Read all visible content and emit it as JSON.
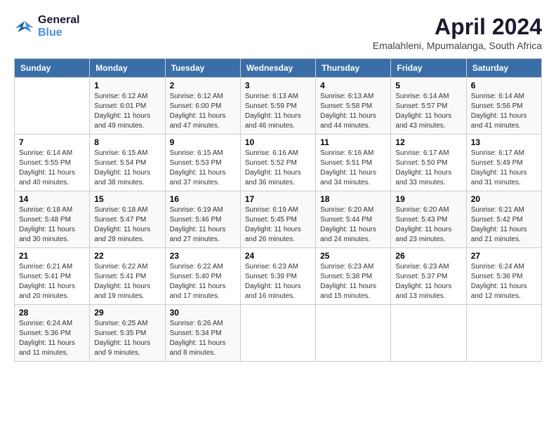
{
  "logo": {
    "text_general": "General",
    "text_blue": "Blue"
  },
  "title": "April 2024",
  "subtitle": "Emalahleni, Mpumalanga, South Africa",
  "days_of_week": [
    "Sunday",
    "Monday",
    "Tuesday",
    "Wednesday",
    "Thursday",
    "Friday",
    "Saturday"
  ],
  "weeks": [
    [
      {
        "day": "",
        "sunrise": "",
        "sunset": "",
        "daylight": ""
      },
      {
        "day": "1",
        "sunrise": "Sunrise: 6:12 AM",
        "sunset": "Sunset: 6:01 PM",
        "daylight": "Daylight: 11 hours and 49 minutes."
      },
      {
        "day": "2",
        "sunrise": "Sunrise: 6:12 AM",
        "sunset": "Sunset: 6:00 PM",
        "daylight": "Daylight: 11 hours and 47 minutes."
      },
      {
        "day": "3",
        "sunrise": "Sunrise: 6:13 AM",
        "sunset": "Sunset: 5:59 PM",
        "daylight": "Daylight: 11 hours and 46 minutes."
      },
      {
        "day": "4",
        "sunrise": "Sunrise: 6:13 AM",
        "sunset": "Sunset: 5:58 PM",
        "daylight": "Daylight: 11 hours and 44 minutes."
      },
      {
        "day": "5",
        "sunrise": "Sunrise: 6:14 AM",
        "sunset": "Sunset: 5:57 PM",
        "daylight": "Daylight: 11 hours and 43 minutes."
      },
      {
        "day": "6",
        "sunrise": "Sunrise: 6:14 AM",
        "sunset": "Sunset: 5:56 PM",
        "daylight": "Daylight: 11 hours and 41 minutes."
      }
    ],
    [
      {
        "day": "7",
        "sunrise": "Sunrise: 6:14 AM",
        "sunset": "Sunset: 5:55 PM",
        "daylight": "Daylight: 11 hours and 40 minutes."
      },
      {
        "day": "8",
        "sunrise": "Sunrise: 6:15 AM",
        "sunset": "Sunset: 5:54 PM",
        "daylight": "Daylight: 11 hours and 38 minutes."
      },
      {
        "day": "9",
        "sunrise": "Sunrise: 6:15 AM",
        "sunset": "Sunset: 5:53 PM",
        "daylight": "Daylight: 11 hours and 37 minutes."
      },
      {
        "day": "10",
        "sunrise": "Sunrise: 6:16 AM",
        "sunset": "Sunset: 5:52 PM",
        "daylight": "Daylight: 11 hours and 36 minutes."
      },
      {
        "day": "11",
        "sunrise": "Sunrise: 6:16 AM",
        "sunset": "Sunset: 5:51 PM",
        "daylight": "Daylight: 11 hours and 34 minutes."
      },
      {
        "day": "12",
        "sunrise": "Sunrise: 6:17 AM",
        "sunset": "Sunset: 5:50 PM",
        "daylight": "Daylight: 11 hours and 33 minutes."
      },
      {
        "day": "13",
        "sunrise": "Sunrise: 6:17 AM",
        "sunset": "Sunset: 5:49 PM",
        "daylight": "Daylight: 11 hours and 31 minutes."
      }
    ],
    [
      {
        "day": "14",
        "sunrise": "Sunrise: 6:18 AM",
        "sunset": "Sunset: 5:48 PM",
        "daylight": "Daylight: 11 hours and 30 minutes."
      },
      {
        "day": "15",
        "sunrise": "Sunrise: 6:18 AM",
        "sunset": "Sunset: 5:47 PM",
        "daylight": "Daylight: 11 hours and 28 minutes."
      },
      {
        "day": "16",
        "sunrise": "Sunrise: 6:19 AM",
        "sunset": "Sunset: 5:46 PM",
        "daylight": "Daylight: 11 hours and 27 minutes."
      },
      {
        "day": "17",
        "sunrise": "Sunrise: 6:19 AM",
        "sunset": "Sunset: 5:45 PM",
        "daylight": "Daylight: 11 hours and 26 minutes."
      },
      {
        "day": "18",
        "sunrise": "Sunrise: 6:20 AM",
        "sunset": "Sunset: 5:44 PM",
        "daylight": "Daylight: 11 hours and 24 minutes."
      },
      {
        "day": "19",
        "sunrise": "Sunrise: 6:20 AM",
        "sunset": "Sunset: 5:43 PM",
        "daylight": "Daylight: 11 hours and 23 minutes."
      },
      {
        "day": "20",
        "sunrise": "Sunrise: 6:21 AM",
        "sunset": "Sunset: 5:42 PM",
        "daylight": "Daylight: 11 hours and 21 minutes."
      }
    ],
    [
      {
        "day": "21",
        "sunrise": "Sunrise: 6:21 AM",
        "sunset": "Sunset: 5:41 PM",
        "daylight": "Daylight: 11 hours and 20 minutes."
      },
      {
        "day": "22",
        "sunrise": "Sunrise: 6:22 AM",
        "sunset": "Sunset: 5:41 PM",
        "daylight": "Daylight: 11 hours and 19 minutes."
      },
      {
        "day": "23",
        "sunrise": "Sunrise: 6:22 AM",
        "sunset": "Sunset: 5:40 PM",
        "daylight": "Daylight: 11 hours and 17 minutes."
      },
      {
        "day": "24",
        "sunrise": "Sunrise: 6:23 AM",
        "sunset": "Sunset: 5:39 PM",
        "daylight": "Daylight: 11 hours and 16 minutes."
      },
      {
        "day": "25",
        "sunrise": "Sunrise: 6:23 AM",
        "sunset": "Sunset: 5:38 PM",
        "daylight": "Daylight: 11 hours and 15 minutes."
      },
      {
        "day": "26",
        "sunrise": "Sunrise: 6:23 AM",
        "sunset": "Sunset: 5:37 PM",
        "daylight": "Daylight: 11 hours and 13 minutes."
      },
      {
        "day": "27",
        "sunrise": "Sunrise: 6:24 AM",
        "sunset": "Sunset: 5:36 PM",
        "daylight": "Daylight: 11 hours and 12 minutes."
      }
    ],
    [
      {
        "day": "28",
        "sunrise": "Sunrise: 6:24 AM",
        "sunset": "Sunset: 5:36 PM",
        "daylight": "Daylight: 11 hours and 11 minutes."
      },
      {
        "day": "29",
        "sunrise": "Sunrise: 6:25 AM",
        "sunset": "Sunset: 5:35 PM",
        "daylight": "Daylight: 11 hours and 9 minutes."
      },
      {
        "day": "30",
        "sunrise": "Sunrise: 6:26 AM",
        "sunset": "Sunset: 5:34 PM",
        "daylight": "Daylight: 11 hours and 8 minutes."
      },
      {
        "day": "",
        "sunrise": "",
        "sunset": "",
        "daylight": ""
      },
      {
        "day": "",
        "sunrise": "",
        "sunset": "",
        "daylight": ""
      },
      {
        "day": "",
        "sunrise": "",
        "sunset": "",
        "daylight": ""
      },
      {
        "day": "",
        "sunrise": "",
        "sunset": "",
        "daylight": ""
      }
    ]
  ]
}
